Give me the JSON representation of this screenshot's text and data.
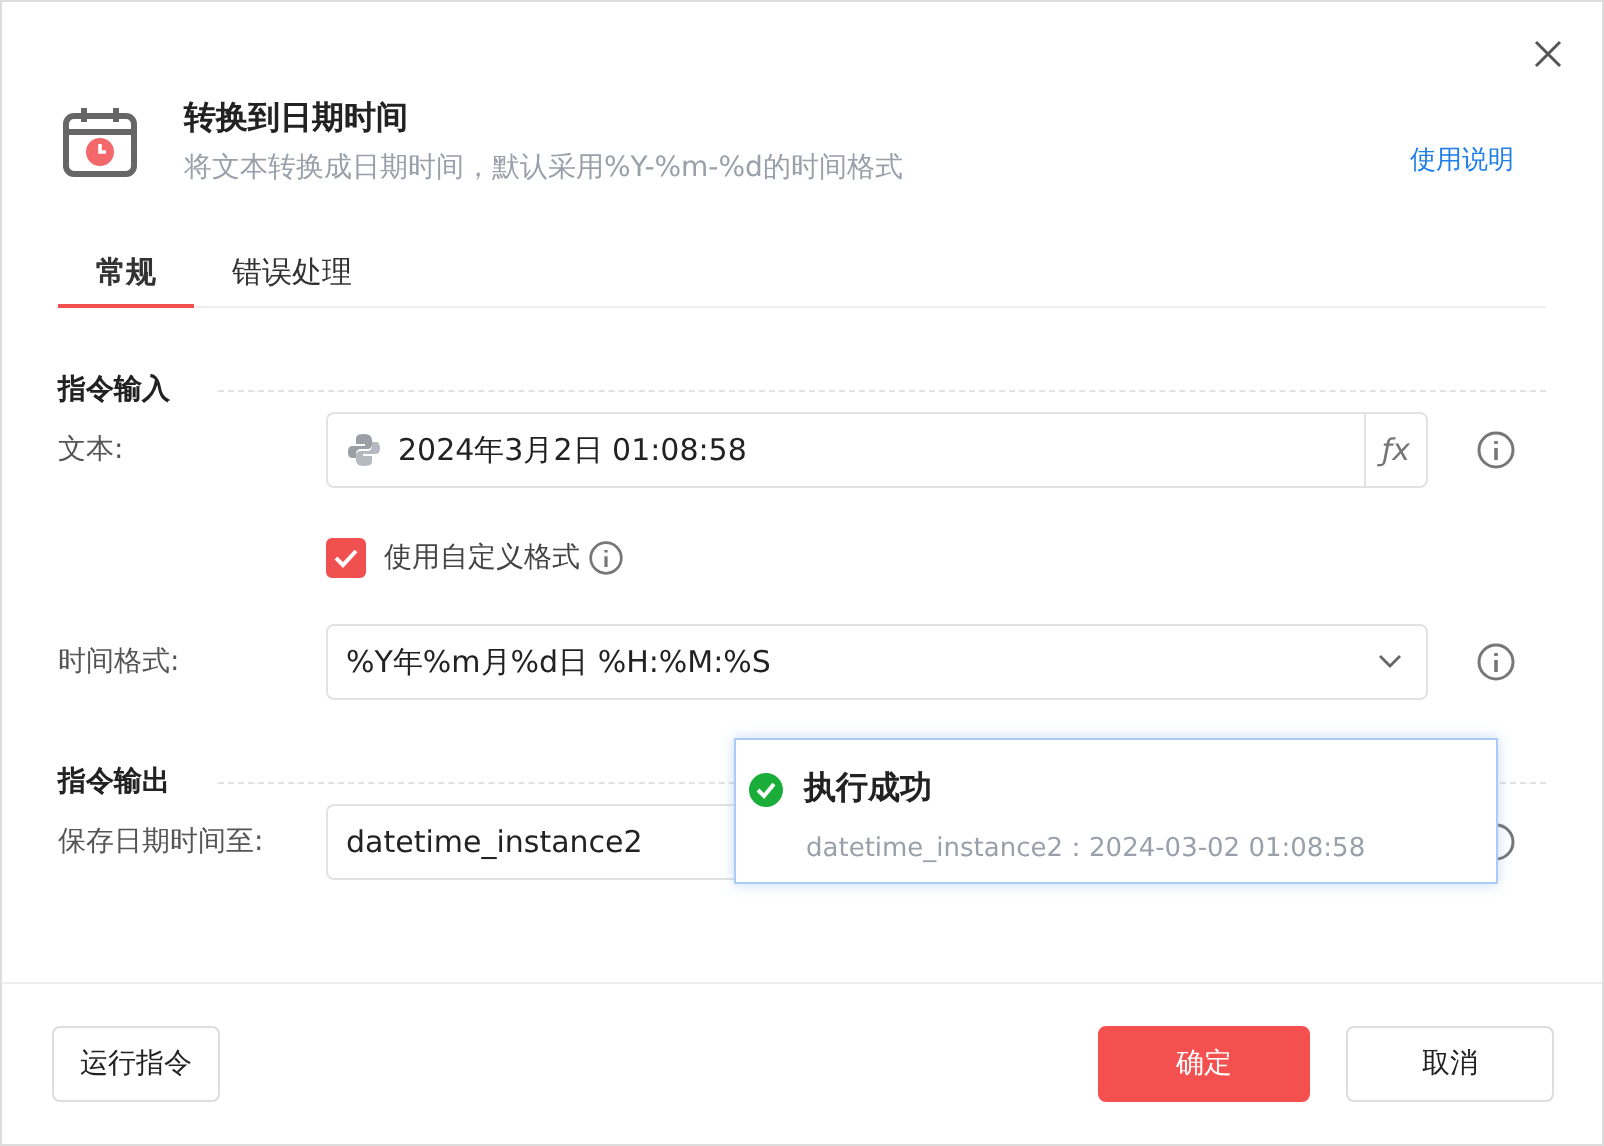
{
  "dialog": {
    "title": "转换到日期时间",
    "subtitle": "将文本转换成日期时间，默认采用%Y-%m-%d的时间格式",
    "help_link": "使用说明"
  },
  "tabs": [
    {
      "label": "常规",
      "selected": true
    },
    {
      "label": "错误处理",
      "selected": false
    }
  ],
  "sections": [
    {
      "title": "指令输入",
      "rows": [
        {
          "kind": "expr",
          "label": "文本:",
          "value": "2024年3月2日 01:08:58",
          "python": true,
          "fx": "ƒx"
        },
        {
          "kind": "checkbox",
          "label": "使用自定义格式",
          "checked": true
        },
        {
          "kind": "select",
          "label": "时间格式:",
          "value": "%Y年%m月%d日 %H:%M:%S"
        }
      ]
    },
    {
      "title": "指令输出",
      "rows": [
        {
          "kind": "expr",
          "label": "保存日期时间至:",
          "value": "datetime_instance2"
        }
      ]
    }
  ],
  "toast": {
    "title": "执行成功",
    "message": "datetime_instance2：2024-03-02 01:08:58"
  },
  "footer": {
    "run": "运行指令",
    "ok": "确定",
    "cancel": "取消"
  }
}
